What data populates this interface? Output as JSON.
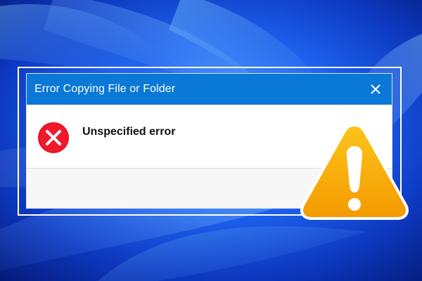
{
  "dialog": {
    "title": "Error Copying File or Folder",
    "message": "Unspecified error",
    "icons": {
      "close": "close-icon",
      "error": "error-icon",
      "warning": "warning-icon"
    }
  },
  "colors": {
    "titlebar": "#0a78d7",
    "desktop": "#1f4fd8",
    "error": "#e81123",
    "warning": "#f5a300"
  }
}
